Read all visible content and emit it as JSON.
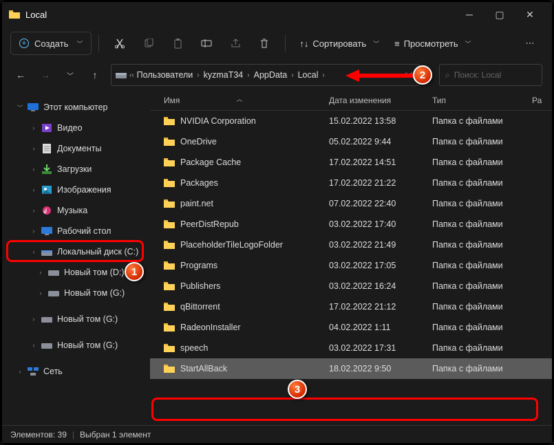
{
  "title": "Local",
  "toolbar": {
    "create": "Создать",
    "sort": "Сортировать",
    "view": "Просмотреть"
  },
  "breadcrumbs": [
    "Пользователи",
    "kyzmaT34",
    "AppData",
    "Local"
  ],
  "search_placeholder": "Поиск: Local",
  "sidebar": {
    "root": "Этот компьютер",
    "items": [
      {
        "label": "Видео"
      },
      {
        "label": "Документы"
      },
      {
        "label": "Загрузки"
      },
      {
        "label": "Изображения"
      },
      {
        "label": "Музыка"
      },
      {
        "label": "Рабочий стол"
      },
      {
        "label": "Локальный диск (C:)"
      },
      {
        "label": "Новый том (D:)"
      },
      {
        "label": "Новый том (G:)"
      },
      {
        "label": "Новый том (G:)"
      },
      {
        "label": "Новый том (G:)"
      }
    ],
    "network": "Сеть"
  },
  "columns": {
    "name": "Имя",
    "date": "Дата изменения",
    "type": "Тип",
    "size": "Ра"
  },
  "type_label": "Папка с файлами",
  "rows": [
    {
      "name": "NVIDIA Corporation",
      "date": "15.02.2022 13:58"
    },
    {
      "name": "OneDrive",
      "date": "05.02.2022 9:44"
    },
    {
      "name": "Package Cache",
      "date": "17.02.2022 14:51"
    },
    {
      "name": "Packages",
      "date": "17.02.2022 21:22"
    },
    {
      "name": "paint.net",
      "date": "07.02.2022 22:40"
    },
    {
      "name": "PeerDistRepub",
      "date": "03.02.2022 17:40"
    },
    {
      "name": "PlaceholderTileLogoFolder",
      "date": "03.02.2022 21:49"
    },
    {
      "name": "Programs",
      "date": "03.02.2022 17:05"
    },
    {
      "name": "Publishers",
      "date": "03.02.2022 16:24"
    },
    {
      "name": "qBittorrent",
      "date": "17.02.2022 21:12"
    },
    {
      "name": "RadeonInstaller",
      "date": "04.02.2022 1:11"
    },
    {
      "name": "speech",
      "date": "03.02.2022 17:31"
    },
    {
      "name": "StartAllBack",
      "date": "18.02.2022 9:50"
    }
  ],
  "status": {
    "elements": "Элементов: 39",
    "selected": "Выбран 1 элемент"
  },
  "annotations": {
    "1": "1",
    "2": "2",
    "3": "3"
  }
}
